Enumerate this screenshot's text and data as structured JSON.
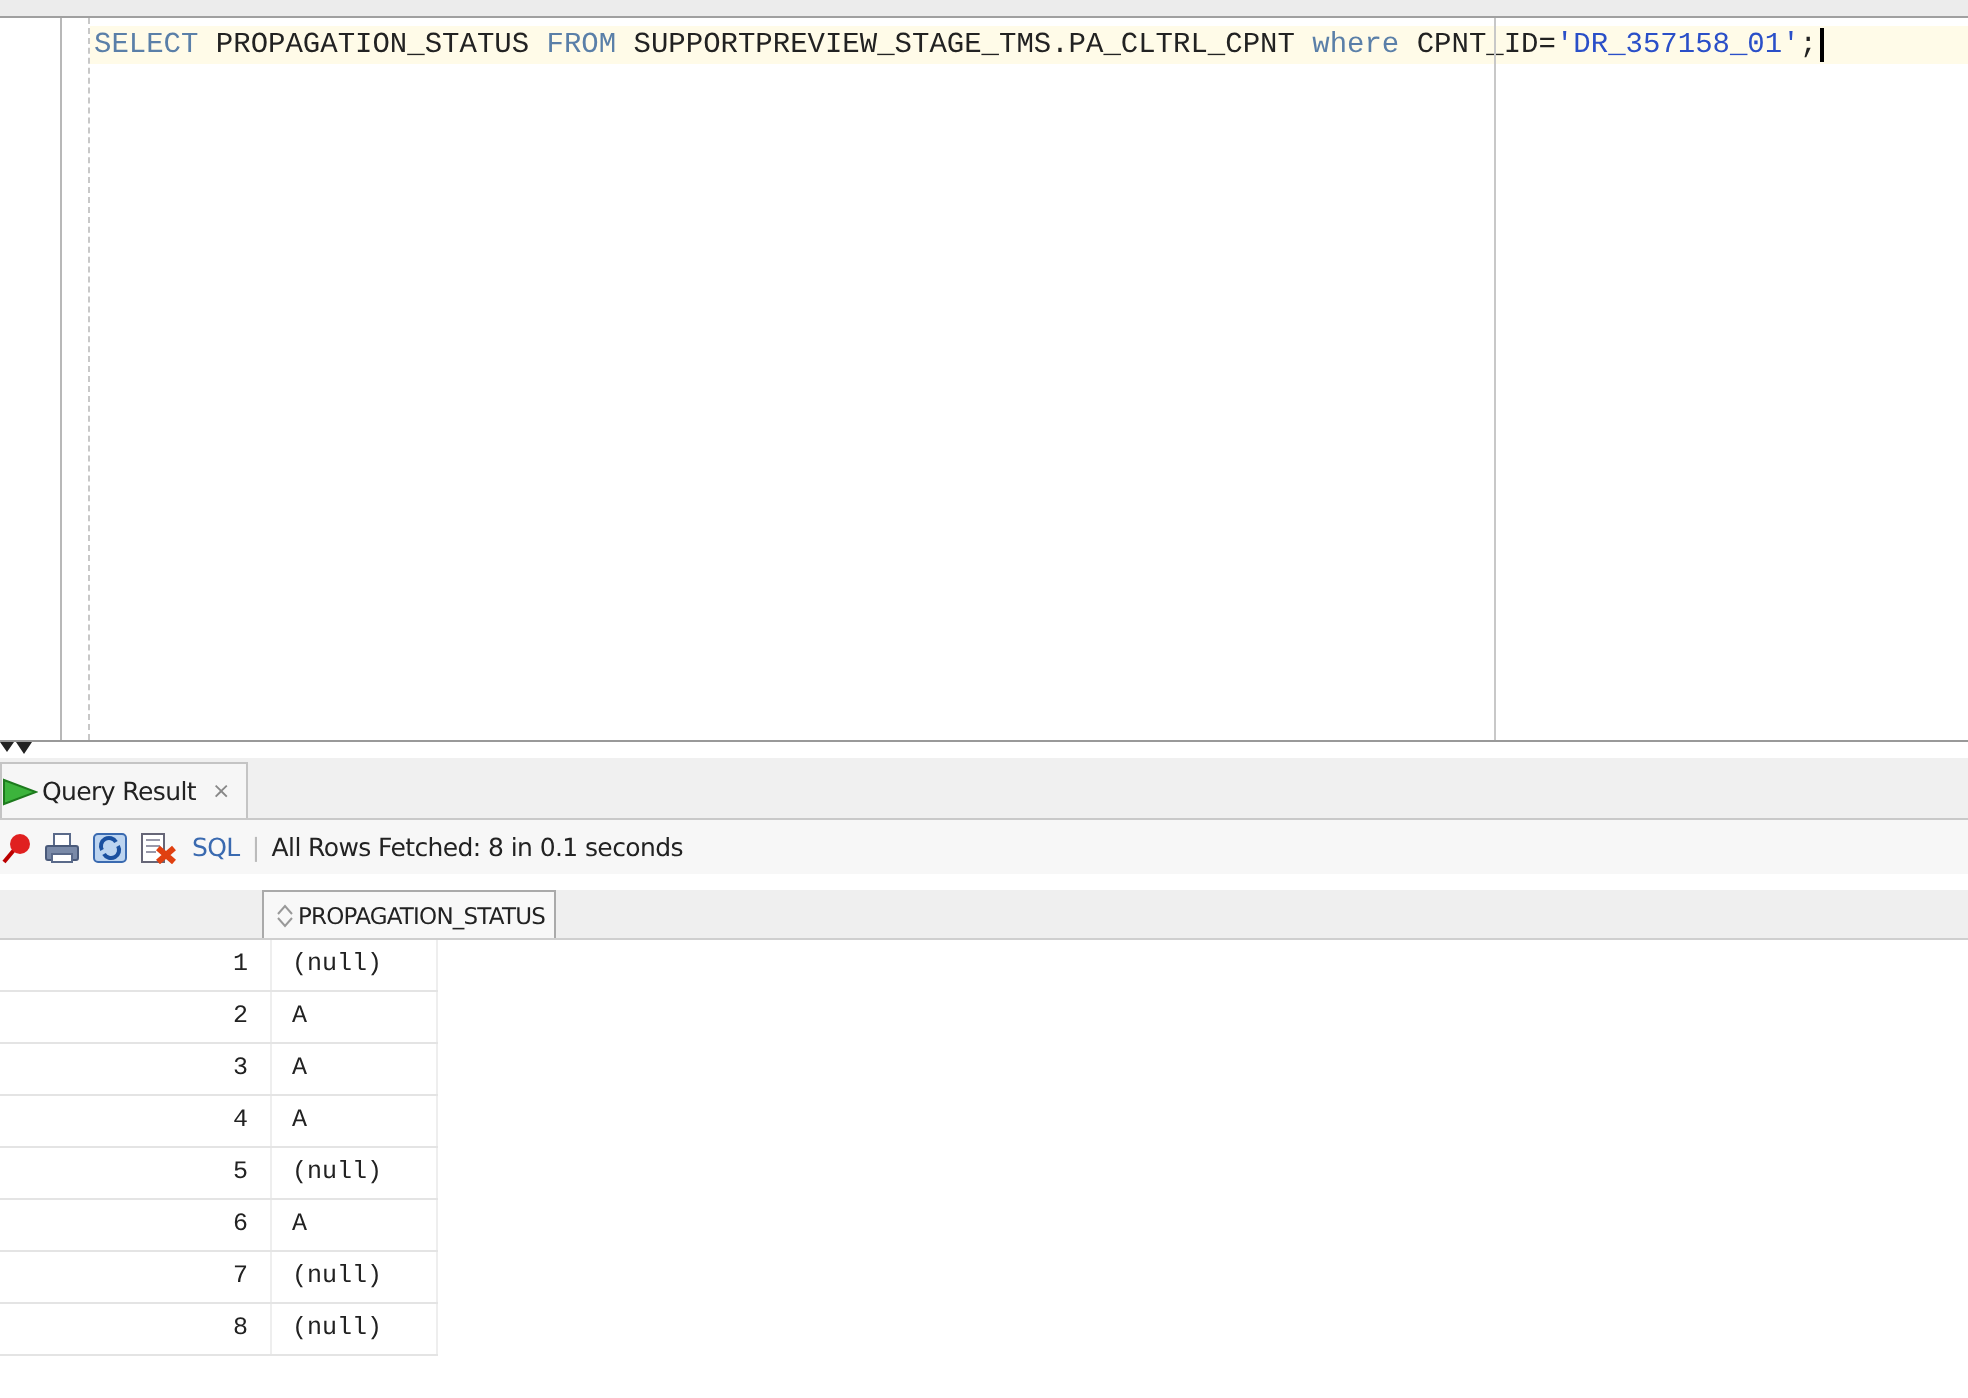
{
  "editor": {
    "lines": [
      {
        "current": true,
        "tokens": [
          {
            "kind": "keyword",
            "text": "SELECT"
          },
          {
            "kind": "plain",
            "text": " PROPAGATION_STATUS "
          },
          {
            "kind": "keyword",
            "text": "FROM"
          },
          {
            "kind": "plain",
            "text": " SUPPORTPREVIEW_STAGE_TMS.PA_CLTRL_CPNT "
          },
          {
            "kind": "keyword",
            "text": "where"
          },
          {
            "kind": "plain",
            "text": " CPNT_ID="
          },
          {
            "kind": "string",
            "text": "'DR_357158_01'"
          },
          {
            "kind": "plain",
            "text": ";"
          }
        ]
      }
    ]
  },
  "result_tab": {
    "label": "Query Result",
    "close": "×",
    "selected": true
  },
  "toolbar": {
    "sql_link": "SQL",
    "separator": "|",
    "status": "All Rows Fetched: 8 in 0.1 seconds"
  },
  "grid": {
    "columns": [
      "PROPAGATION_STATUS"
    ],
    "rows": [
      {
        "number": "1",
        "cells": [
          "(null)"
        ]
      },
      {
        "number": "2",
        "cells": [
          "A"
        ]
      },
      {
        "number": "3",
        "cells": [
          "A"
        ]
      },
      {
        "number": "4",
        "cells": [
          "A"
        ]
      },
      {
        "number": "5",
        "cells": [
          "(null)"
        ]
      },
      {
        "number": "6",
        "cells": [
          "A"
        ]
      },
      {
        "number": "7",
        "cells": [
          "(null)"
        ]
      },
      {
        "number": "8",
        "cells": [
          "(null)"
        ]
      }
    ]
  }
}
